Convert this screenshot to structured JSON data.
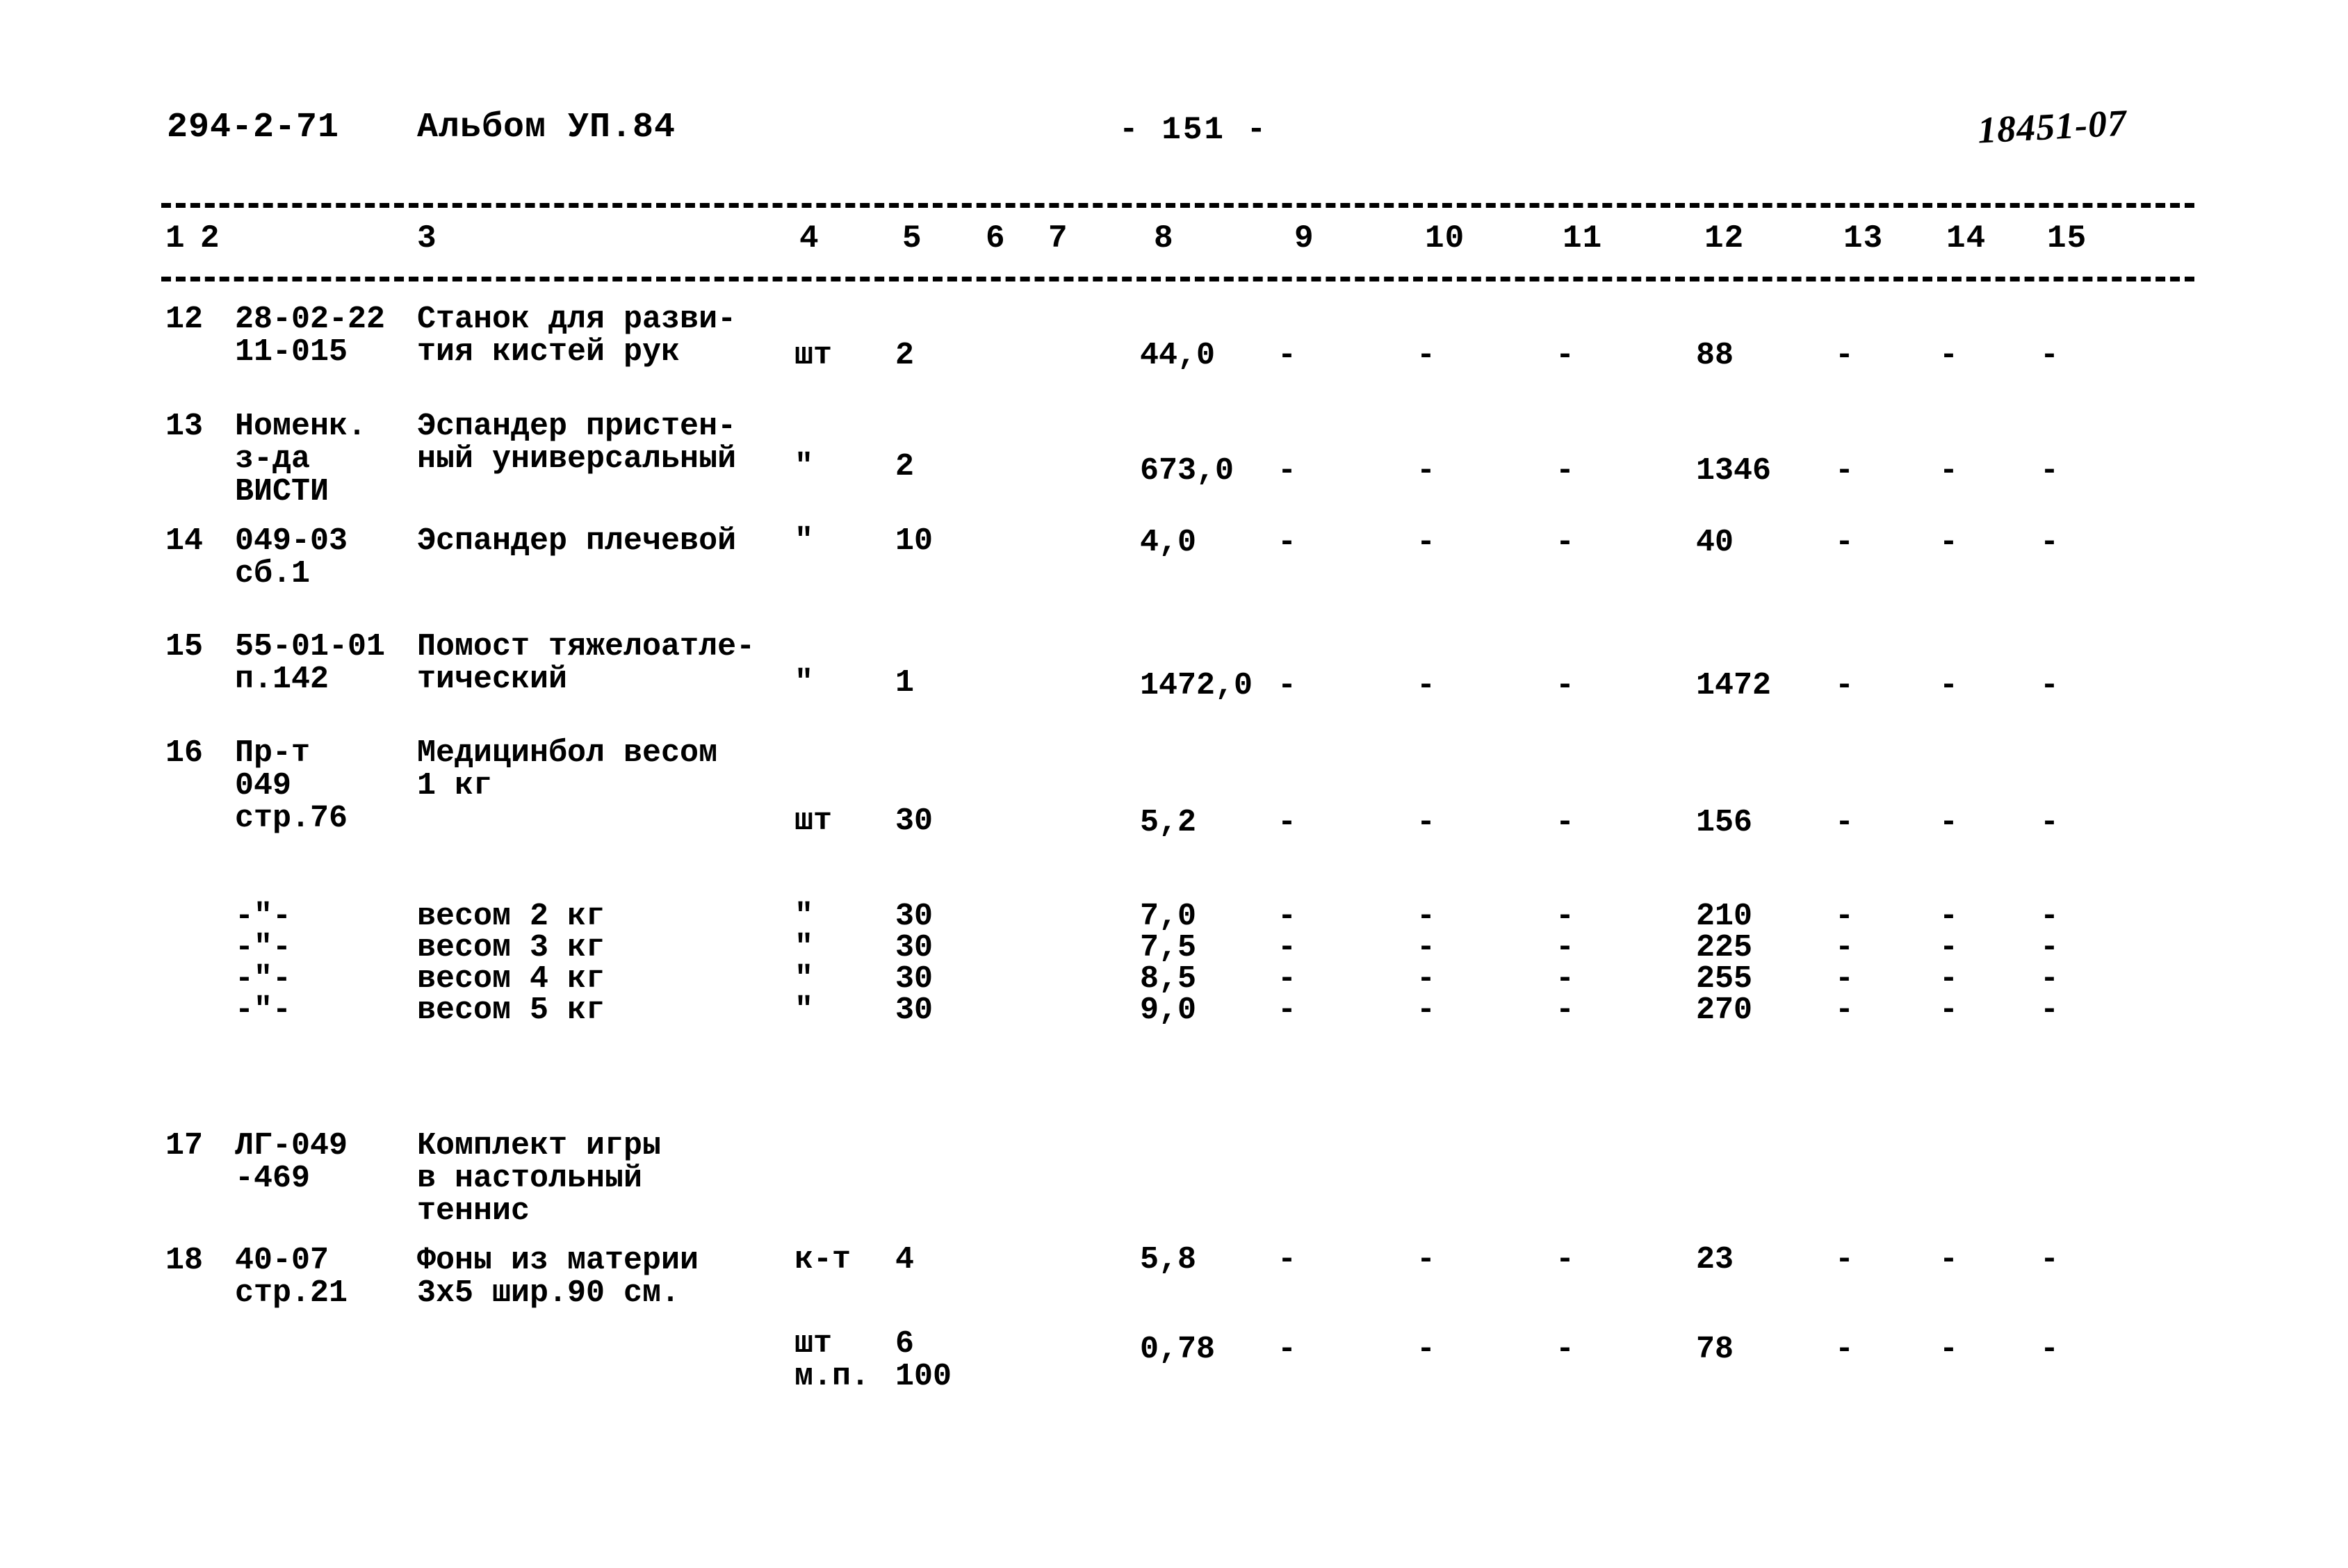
{
  "header": {
    "doc_code": "294-2-71",
    "album": "Альбом УП.84",
    "page_number": "- 151 -",
    "stamp": "18451-07"
  },
  "table": {
    "column_headers": [
      "1",
      "2",
      "3",
      "4",
      "5",
      "6",
      "7",
      "8",
      "9",
      "10",
      "11",
      "12",
      "13",
      "14",
      "15"
    ],
    "rows": [
      {
        "num": "12",
        "code": "28-02-22\n11-015",
        "name": "Станок для разви-\nтия кистей рук",
        "unit": "шт",
        "qty": "2",
        "c6": "",
        "c7": "",
        "price": "44,0",
        "c9": "-",
        "c10": "-",
        "c11": "-",
        "total": "88",
        "c13": "-",
        "c14": "-",
        "c15": "-"
      },
      {
        "num": "13",
        "code": "Номенк.\nз-да\nВИСТИ",
        "name": "Эспандер пристен-\nный универсальный",
        "unit": "\"",
        "qty": "2",
        "c6": "",
        "c7": "",
        "price": "673,0",
        "c9": "-",
        "c10": "-",
        "c11": "-",
        "total": "1346",
        "c13": "-",
        "c14": "-",
        "c15": "-"
      },
      {
        "num": "14",
        "code": "049-03\nсб.1",
        "name": "Эспандер плечевой",
        "unit": "\"",
        "qty": "10",
        "c6": "",
        "c7": "",
        "price": "4,0",
        "c9": "-",
        "c10": "-",
        "c11": "-",
        "total": "40",
        "c13": "-",
        "c14": "-",
        "c15": "-"
      },
      {
        "num": "15",
        "code": "55-01-01\nп.142",
        "name": "Помост тяжелоатле-\nтический",
        "unit": "\"",
        "qty": "1",
        "c6": "",
        "c7": "",
        "price": "1472,0",
        "c9": "-",
        "c10": "-",
        "c11": "-",
        "total": "1472",
        "c13": "-",
        "c14": "-",
        "c15": "-"
      },
      {
        "num": "16",
        "code": "Пр-т\n049\nстр.76",
        "name": "Медицинбол весом\n1 кг",
        "unit": "шт",
        "qty": "30",
        "c6": "",
        "c7": "",
        "price": "5,2",
        "c9": "-",
        "c10": "-",
        "c11": "-",
        "total": "156",
        "c13": "-",
        "c14": "-",
        "c15": "-"
      },
      {
        "num": "",
        "code": "-\"-",
        "name": "весом 2 кг",
        "unit": "\"",
        "qty": "30",
        "c6": "",
        "c7": "",
        "price": "7,0",
        "c9": "-",
        "c10": "-",
        "c11": "-",
        "total": "210",
        "c13": "-",
        "c14": "-",
        "c15": "-"
      },
      {
        "num": "",
        "code": "-\"-",
        "name": "весом 3 кг",
        "unit": "\"",
        "qty": "30",
        "c6": "",
        "c7": "",
        "price": "7,5",
        "c9": "-",
        "c10": "-",
        "c11": "-",
        "total": "225",
        "c13": "-",
        "c14": "-",
        "c15": "-"
      },
      {
        "num": "",
        "code": "-\"-",
        "name": "весом 4 кг",
        "unit": "\"",
        "qty": "30",
        "c6": "",
        "c7": "",
        "price": "8,5",
        "c9": "-",
        "c10": "-",
        "c11": "-",
        "total": "255",
        "c13": "-",
        "c14": "-",
        "c15": "-"
      },
      {
        "num": "",
        "code": "-\"-",
        "name": "весом 5 кг",
        "unit": "\"",
        "qty": "30",
        "c6": "",
        "c7": "",
        "price": "9,0",
        "c9": "-",
        "c10": "-",
        "c11": "-",
        "total": "270",
        "c13": "-",
        "c14": "-",
        "c15": "-"
      },
      {
        "num": "17",
        "code": "ЛГ-049\n-469",
        "name": "Комплект игры\nв настольный\nтеннис",
        "unit": "к-т",
        "qty": "4",
        "c6": "",
        "c7": "",
        "price": "5,8",
        "c9": "-",
        "c10": "-",
        "c11": "-",
        "total": "23",
        "c13": "-",
        "c14": "-",
        "c15": "-"
      },
      {
        "num": "18",
        "code": "40-07\nстр.21",
        "name": "Фоны из материи\n3х5 шир.90 см.",
        "unit": "шт\nм.п.",
        "qty": "6\n100",
        "c6": "",
        "c7": "",
        "price": "0,78",
        "c9": "-",
        "c10": "-",
        "c11": "-",
        "total": "78",
        "c13": "-",
        "c14": "-",
        "c15": "-"
      }
    ]
  }
}
